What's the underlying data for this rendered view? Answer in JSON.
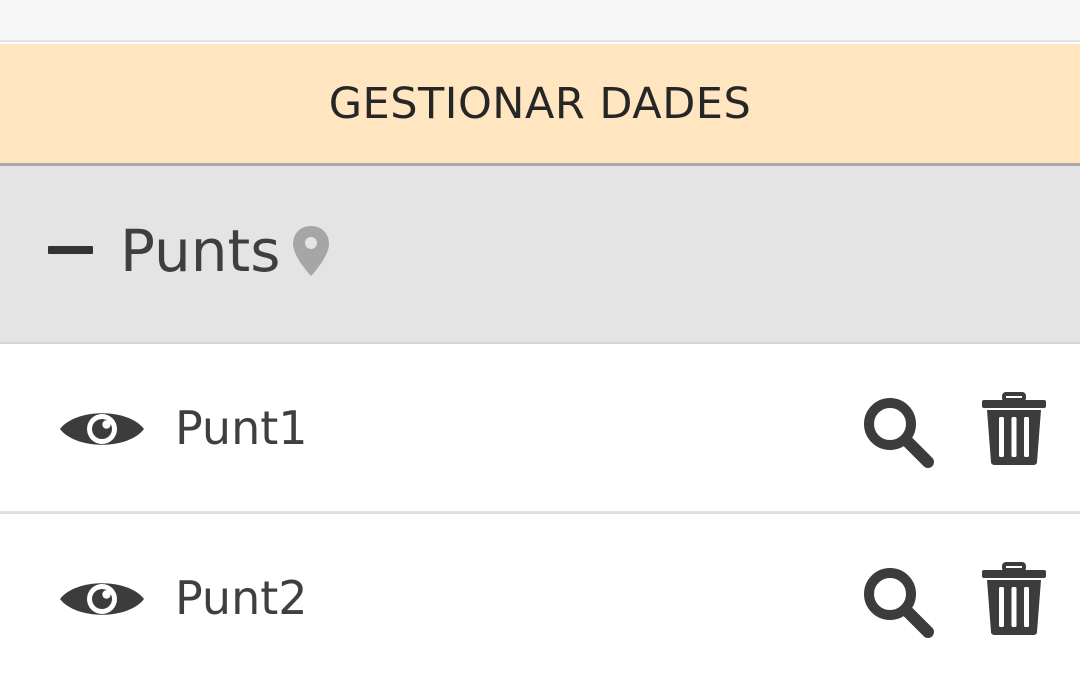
{
  "panel": {
    "manage_button_label": "GESTIONAR DADES"
  },
  "group": {
    "title": "Punts",
    "collapse_icon": "minus-icon",
    "type_icon": "map-pin-icon",
    "items": [
      {
        "label": "Punt1",
        "visibility_icon": "eye-icon",
        "zoom_icon": "magnifier-icon",
        "delete_icon": "trash-icon"
      },
      {
        "label": "Punt2",
        "visibility_icon": "eye-icon",
        "zoom_icon": "magnifier-icon",
        "delete_icon": "trash-icon"
      }
    ]
  },
  "colors": {
    "manage_button_bg": "#ffe6c1",
    "group_header_bg": "#e4e4e4",
    "icon_dark": "#3c3c3c",
    "pin_gray": "#a6a6a6"
  }
}
